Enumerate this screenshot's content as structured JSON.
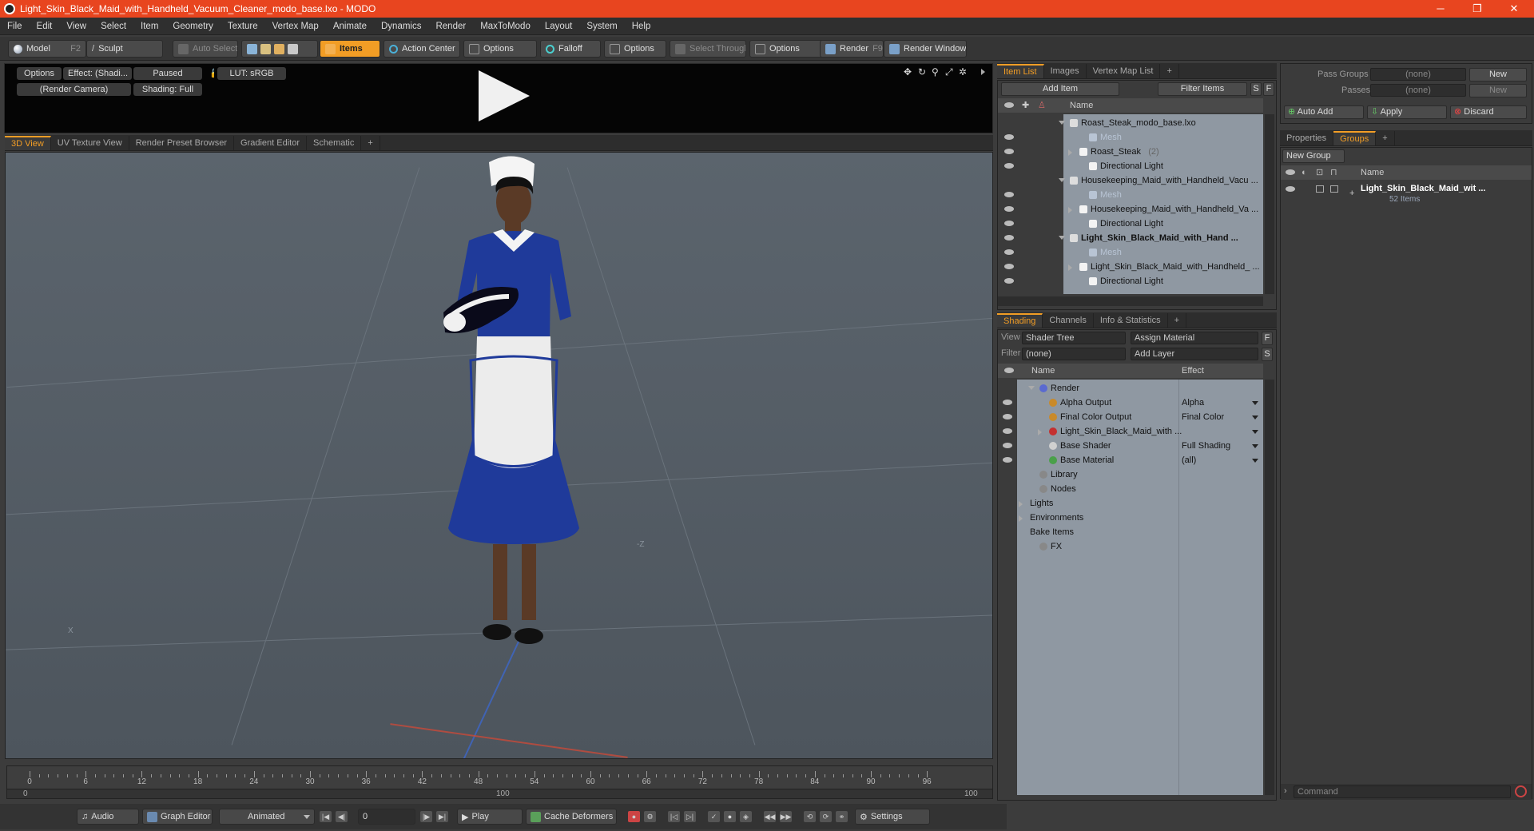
{
  "window": {
    "title": "Light_Skin_Black_Maid_with_Handheld_Vacuum_Cleaner_modo_base.lxo - MODO",
    "minimize": "─",
    "restore": "❐",
    "close": "✕"
  },
  "menu": [
    "File",
    "Edit",
    "View",
    "Select",
    "Item",
    "Geometry",
    "Texture",
    "Vertex Map",
    "Animate",
    "Dynamics",
    "Render",
    "MaxToModo",
    "Layout",
    "System",
    "Help"
  ],
  "toolbar": {
    "model": "Model",
    "model_key": "F2",
    "sculpt": "Sculpt",
    "auto_select": "Auto Select",
    "items": "Items",
    "action_center": "Action Center",
    "options1": "Options",
    "falloff": "Falloff",
    "options2": "Options",
    "select_through": "Select Through",
    "options3": "Options",
    "render": "Render",
    "render_key": "F9",
    "render_window": "Render Window"
  },
  "preview": {
    "options": "Options",
    "effect": "Effect: (Shadi...",
    "paused": "Paused",
    "lut": "LUT: sRGB",
    "camera": "(Render Camera)",
    "shading": "Shading: Full"
  },
  "viewport_tabs": [
    "3D View",
    "UV Texture View",
    "Render Preset Browser",
    "Gradient Editor",
    "Schematic",
    "+"
  ],
  "viewport": {
    "axis_z": "-Z",
    "axis_x": "X"
  },
  "timeline": {
    "ticks": [
      "0",
      "6",
      "12",
      "18",
      "24",
      "30",
      "36",
      "42",
      "48",
      "54",
      "60",
      "66",
      "72",
      "78",
      "84",
      "90",
      "96"
    ],
    "lower_start": "0",
    "lower_mid": "100",
    "lower_end": "100"
  },
  "bottom": {
    "audio": "Audio",
    "graph_editor": "Graph Editor",
    "animated": "Animated",
    "frame": "0",
    "play": "Play",
    "cache_deformers": "Cache Deformers",
    "settings": "Settings"
  },
  "item_list": {
    "tabs": [
      "Item List",
      "Images",
      "Vertex Map List",
      "+"
    ],
    "add_item": "Add Item",
    "filter_items": "Filter Items",
    "s": "S",
    "f": "F",
    "name_header": "Name",
    "rows": [
      {
        "label": "Roast_Steak_modo_base.lxo",
        "indent": 0,
        "expand": "down",
        "dim": false,
        "bold": false,
        "eye": false
      },
      {
        "label": "Mesh",
        "indent": 2,
        "expand": "",
        "dim": true,
        "bold": false,
        "eye": true
      },
      {
        "label": "Roast_Steak",
        "suffix": "(2)",
        "indent": 1,
        "expand": "right",
        "dim": false,
        "bold": false,
        "eye": true
      },
      {
        "label": "Directional Light",
        "indent": 2,
        "expand": "",
        "dim": false,
        "bold": false,
        "eye": true
      },
      {
        "label": "Housekeeping_Maid_with_Handheld_Vacu ...",
        "indent": 0,
        "expand": "down",
        "dim": false,
        "bold": false,
        "eye": false
      },
      {
        "label": "Mesh",
        "indent": 2,
        "expand": "",
        "dim": true,
        "bold": false,
        "eye": true
      },
      {
        "label": "Housekeeping_Maid_with_Handheld_Va ...",
        "indent": 1,
        "expand": "right",
        "dim": false,
        "bold": false,
        "eye": true
      },
      {
        "label": "Directional Light",
        "indent": 2,
        "expand": "",
        "dim": false,
        "bold": false,
        "eye": true
      },
      {
        "label": "Light_Skin_Black_Maid_with_Hand ...",
        "indent": 0,
        "expand": "down",
        "dim": false,
        "bold": true,
        "eye": true
      },
      {
        "label": "Mesh",
        "indent": 2,
        "expand": "",
        "dim": true,
        "bold": false,
        "eye": true
      },
      {
        "label": "Light_Skin_Black_Maid_with_Handheld_ ...",
        "indent": 1,
        "expand": "right",
        "dim": false,
        "bold": false,
        "eye": true
      },
      {
        "label": "Directional Light",
        "indent": 2,
        "expand": "",
        "dim": false,
        "bold": false,
        "eye": true
      }
    ]
  },
  "shading": {
    "tabs": [
      "Shading",
      "Channels",
      "Info & Statistics",
      "+"
    ],
    "view_label": "View",
    "view_value": "Shader Tree",
    "assign_material": "Assign Material",
    "f": "F",
    "filter_label": "Filter",
    "filter_value": "(none)",
    "add_layer": "Add Layer",
    "s": "S",
    "name_header": "Name",
    "effect_header": "Effect",
    "rows": [
      {
        "label": "Render",
        "effect": "",
        "indent": 0,
        "expand": "down",
        "eye": false,
        "icon": "#5a6ad0"
      },
      {
        "label": "Alpha Output",
        "effect": "Alpha",
        "indent": 1,
        "expand": "",
        "eye": true,
        "icon": "#c98a2a"
      },
      {
        "label": "Final Color Output",
        "effect": "Final Color",
        "indent": 1,
        "expand": "",
        "eye": true,
        "icon": "#c98a2a"
      },
      {
        "label": "Light_Skin_Black_Maid_with ...",
        "effect": "",
        "indent": 1,
        "expand": "right",
        "eye": true,
        "icon": "#c43030"
      },
      {
        "label": "Base Shader",
        "effect": "Full Shading",
        "indent": 1,
        "expand": "",
        "eye": true,
        "icon": "#d0d0d0"
      },
      {
        "label": "Base Material",
        "effect": "(all)",
        "indent": 1,
        "expand": "",
        "eye": true,
        "icon": "#4aa04a"
      },
      {
        "label": "Library",
        "effect": "",
        "indent": 0,
        "expand": "",
        "eye": false,
        "icon": "#888"
      },
      {
        "label": "Nodes",
        "effect": "",
        "indent": 0,
        "expand": "",
        "eye": false,
        "icon": "#888"
      },
      {
        "label": "Lights",
        "effect": "",
        "indent": -1,
        "expand": "right",
        "eye": false,
        "icon": ""
      },
      {
        "label": "Environments",
        "effect": "",
        "indent": -1,
        "expand": "right",
        "eye": false,
        "icon": ""
      },
      {
        "label": "Bake Items",
        "effect": "",
        "indent": -1,
        "expand": "",
        "eye": false,
        "icon": ""
      },
      {
        "label": "FX",
        "effect": "",
        "indent": 0,
        "expand": "",
        "eye": false,
        "icon": "#888"
      }
    ]
  },
  "right": {
    "pass_groups_label": "Pass Groups",
    "pass_groups_value": "(none)",
    "new": "New",
    "passes_label": "Passes",
    "passes_value": "(none)",
    "new2": "New",
    "auto_add": "Auto Add",
    "apply": "Apply",
    "discard": "Discard",
    "tabs": [
      "Properties",
      "Groups",
      "+"
    ],
    "new_group": "New Group",
    "name_header": "Name",
    "group_name": "Light_Skin_Black_Maid_wit ...",
    "group_count": "52 Items",
    "command_placeholder": "Command"
  }
}
